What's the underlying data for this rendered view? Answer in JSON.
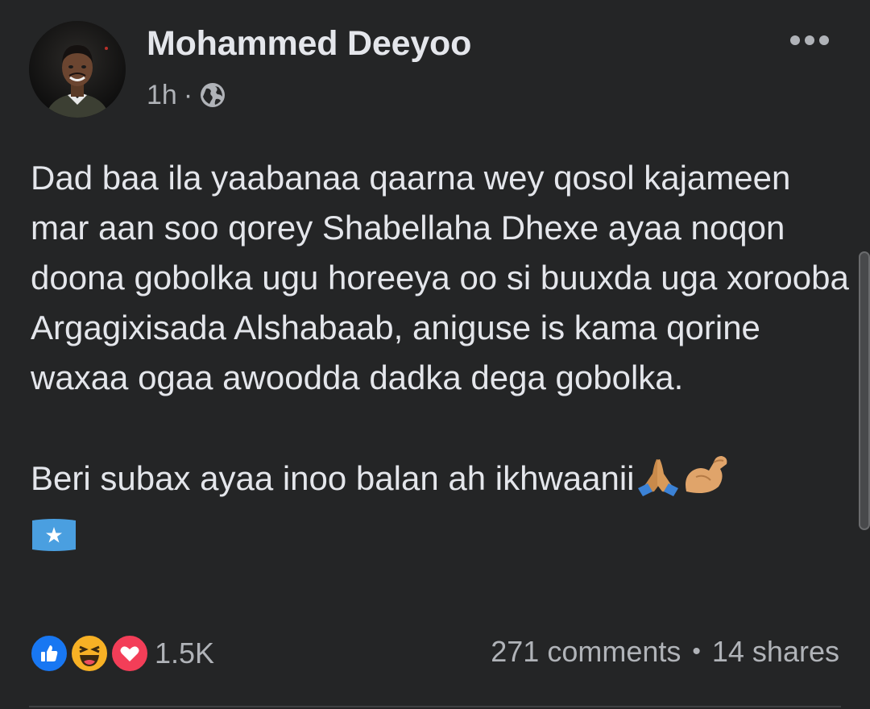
{
  "post": {
    "author": "Mohammed Deeyoo",
    "time": "1h",
    "separator": "·",
    "privacy_icon": "globe-icon",
    "more_icon": "more-horizontal-icon",
    "body": {
      "paragraph1": "Dad baa ila yaabanaa qaarna wey qosol kajameen mar aan soo qorey Shabellaha Dhexe ayaa noqon doona gobolka ugu horeeya oo si buuxda uga xorooba Argagixisada Alshabaab, aniguse is kama qorine waxaa ogaa awoodda dadka dega gobolka.",
      "paragraph2": "Beri subax ayaa inoo balan ah ikhwaanii",
      "emojis": [
        "folded-hands-emoji",
        "flexed-biceps-emoji",
        "somalia-flag-emoji"
      ]
    },
    "reactions": {
      "icons": [
        "like-icon",
        "haha-icon",
        "love-icon"
      ],
      "count": "1.5K"
    },
    "comments": "271 comments",
    "dot": "•",
    "shares": "14 shares"
  },
  "colors": {
    "background": "#242526",
    "text_primary": "#e4e6eb",
    "text_secondary": "#b0b3b8",
    "like_blue": "#1877f2",
    "love_red": "#f33e58",
    "haha_yellow": "#f7b125"
  }
}
